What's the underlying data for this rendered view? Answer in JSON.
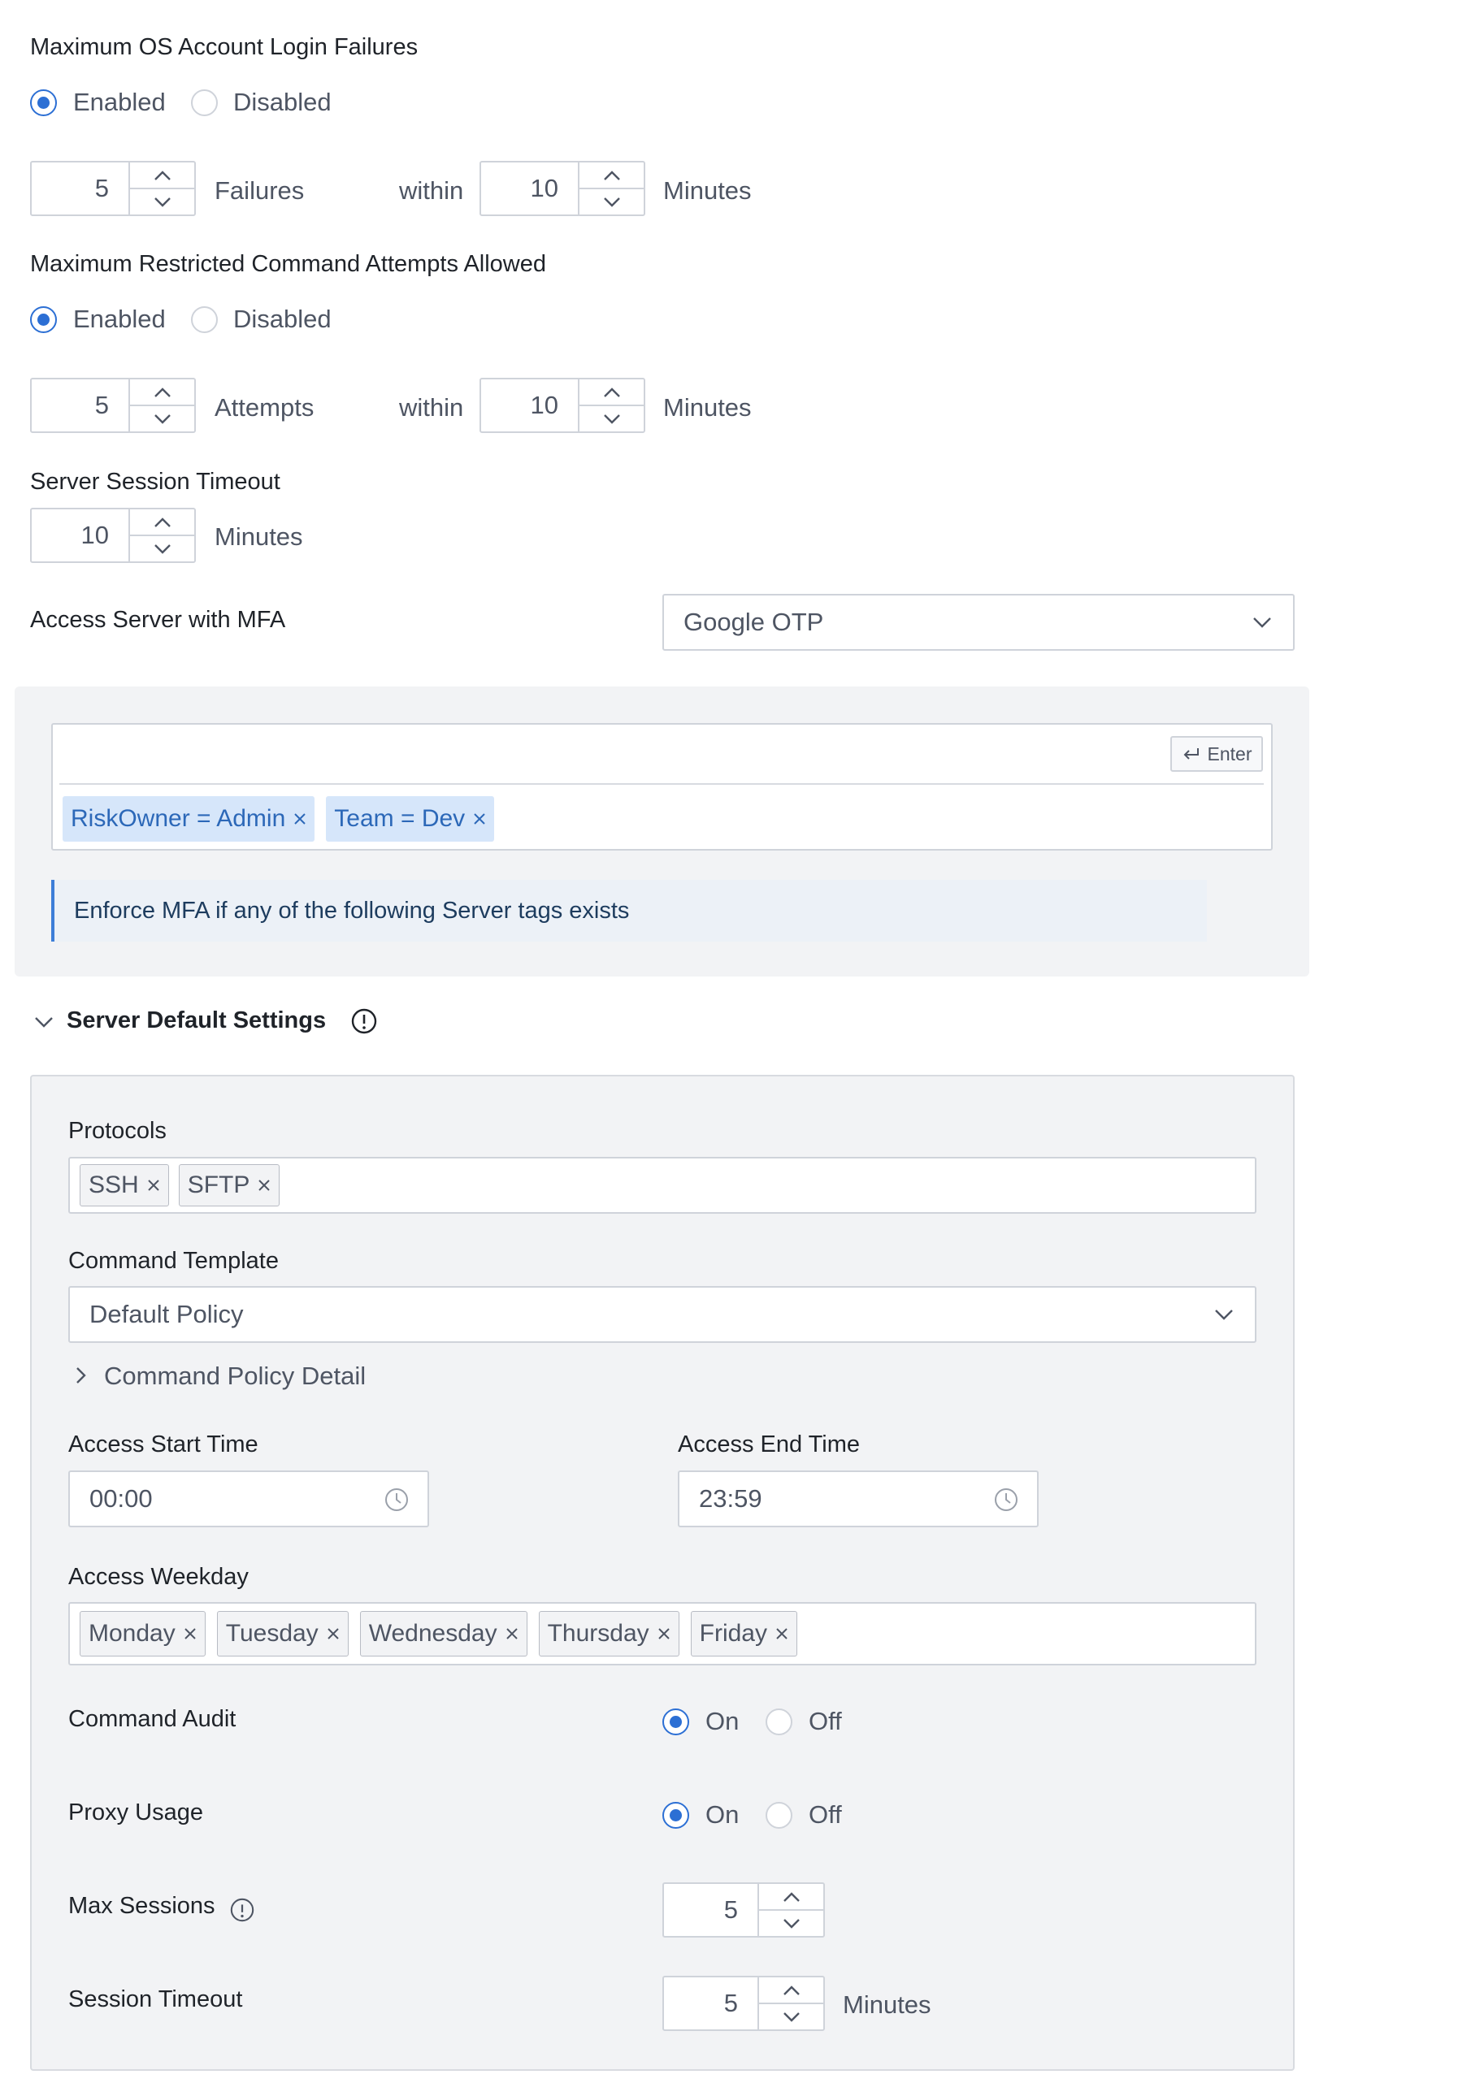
{
  "login_failures": {
    "title": "Maximum OS Account Login Failures",
    "enabled_label": "Enabled",
    "disabled_label": "Disabled",
    "selected": "Enabled",
    "count": "5",
    "count_unit": "Failures",
    "within_label": "within",
    "window": "10",
    "window_unit": "Minutes"
  },
  "restricted_commands": {
    "title": "Maximum Restricted Command Attempts Allowed",
    "enabled_label": "Enabled",
    "disabled_label": "Disabled",
    "selected": "Enabled",
    "count": "5",
    "count_unit": "Attempts",
    "within_label": "within",
    "window": "10",
    "window_unit": "Minutes"
  },
  "server_session_timeout": {
    "title": "Server Session Timeout",
    "value": "10",
    "unit": "Minutes"
  },
  "mfa": {
    "label": "Access Server with MFA",
    "selected": "Google OTP",
    "enter_label": "Enter",
    "tags": [
      "RiskOwner = Admin",
      "Team = Dev"
    ],
    "hint": "Enforce MFA if any of the following Server tags exists"
  },
  "defaults": {
    "section_title": "Server Default Settings",
    "protocols_label": "Protocols",
    "protocols": [
      "SSH",
      "SFTP"
    ],
    "command_template_label": "Command Template",
    "command_template": "Default Policy",
    "command_policy_detail": "Command Policy Detail",
    "start_time_label": "Access Start Time",
    "start_time": "00:00",
    "end_time_label": "Access End Time",
    "end_time": "23:59",
    "weekday_label": "Access Weekday",
    "weekdays": [
      "Monday",
      "Tuesday",
      "Wednesday",
      "Thursday",
      "Friday"
    ],
    "command_audit_label": "Command Audit",
    "command_audit": "On",
    "proxy_usage_label": "Proxy Usage",
    "proxy_usage": "On",
    "on_label": "On",
    "off_label": "Off",
    "max_sessions_label": "Max Sessions",
    "max_sessions": "5",
    "session_timeout_label": "Session Timeout",
    "session_timeout": "5",
    "session_timeout_unit": "Minutes"
  },
  "colors": {
    "accent": "#2c6fd4",
    "tag_blue_bg": "#d6e6fa",
    "panel_bg": "#f2f3f5"
  }
}
